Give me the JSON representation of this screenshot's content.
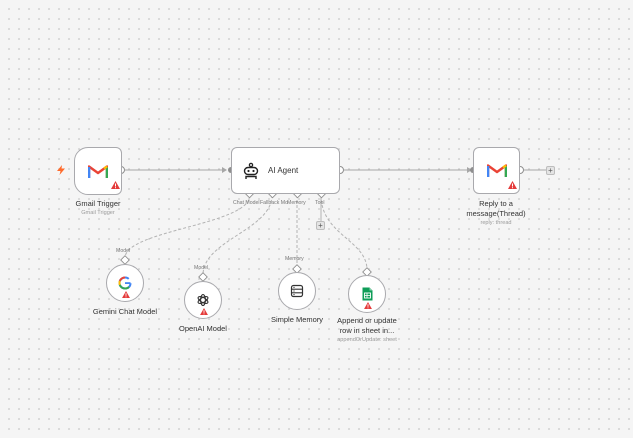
{
  "nodes": {
    "gmail_trigger": {
      "name": "Gmail Trigger",
      "subtitle": "Gmail Trigger"
    },
    "ai_agent": {
      "name": "AI Agent",
      "inputs": [
        "Chat Model",
        "Fallback Mo",
        "Memory",
        "Tool"
      ]
    },
    "reply": {
      "name_line1": "Reply to a",
      "name_line2": "message(Thread)",
      "subtitle": "reply: thread"
    },
    "gemini": {
      "name": "Gemini Chat Model",
      "connector": "Model"
    },
    "openai": {
      "name": "OpenAI Model",
      "connector": "Model"
    },
    "memory": {
      "name": "Simple Memory",
      "connector": "Memory"
    },
    "sheets": {
      "name_line1": "Append or update",
      "name_line2": "row in sheet in...",
      "subtitle": "appendOrUpdate: sheet"
    }
  },
  "add_buttons": {
    "after_reply": "+",
    "agent_tool": "+"
  },
  "colors": {
    "warning": "#e43b3b",
    "trigger_bolt": "#ff6b2c",
    "gmail_red": "#ea4335",
    "gmail_blue": "#4285f4",
    "gmail_green": "#34a853",
    "gmail_yellow": "#fbbc04",
    "sheets_green": "#0f9d58",
    "edge": "#a7a7a7"
  },
  "icons": [
    "trigger-bolt-icon",
    "gmail-icon",
    "robot-icon",
    "google-g-icon",
    "openai-icon",
    "database-icon",
    "google-sheets-icon",
    "warning-icon"
  ]
}
